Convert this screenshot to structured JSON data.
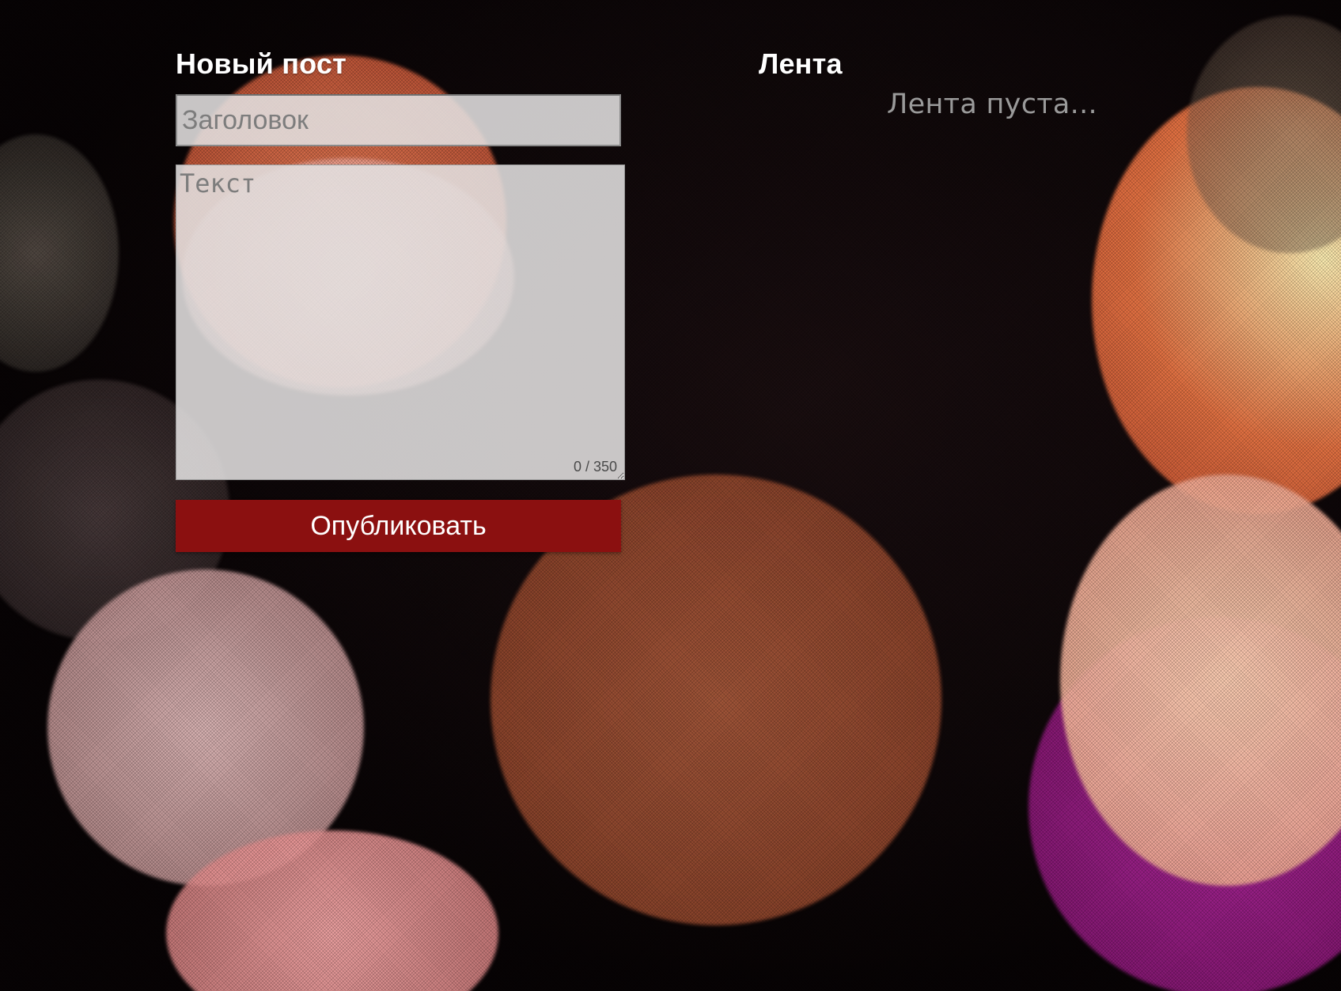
{
  "new_post": {
    "heading": "Новый пост",
    "title_placeholder": "Заголовок",
    "title_value": "",
    "text_placeholder": "Текст",
    "text_value": "",
    "counter": "0 / 350",
    "publish_label": "Опубликовать"
  },
  "feed": {
    "heading": "Лента",
    "empty_message": "Лента пуста..."
  },
  "colors": {
    "accent_button": "#8b1010",
    "heading_text": "#ffffff",
    "muted_text": "#9a9a9a",
    "field_background": "#e2e0e0"
  }
}
